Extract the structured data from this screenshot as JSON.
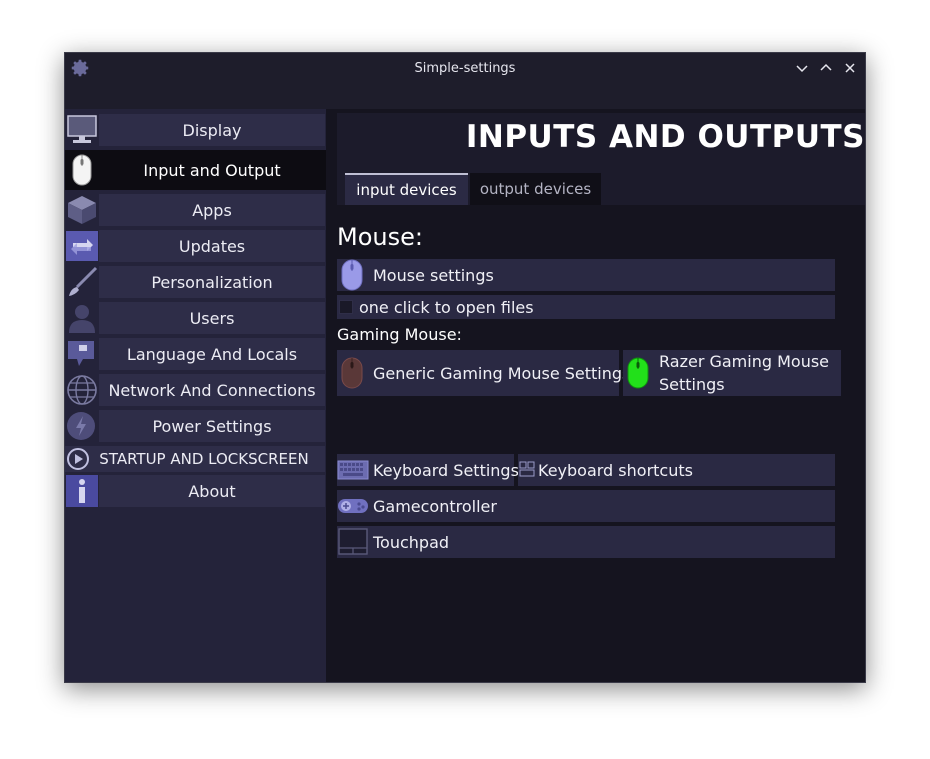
{
  "window": {
    "title": "Simple-settings"
  },
  "sidebar": {
    "items": [
      {
        "label": "Display",
        "icon": "monitor-icon"
      },
      {
        "label": "Input and Output",
        "icon": "mouse-icon"
      },
      {
        "label": "Apps",
        "icon": "package-icon"
      },
      {
        "label": "Updates",
        "icon": "refresh-icon"
      },
      {
        "label": "Personalization",
        "icon": "paintbrush-icon"
      },
      {
        "label": "Users",
        "icon": "user-icon"
      },
      {
        "label": "Language And Locals",
        "icon": "language-icon"
      },
      {
        "label": "Network And Connections",
        "icon": "globe-icon"
      },
      {
        "label": "Power Settings",
        "icon": "power-icon"
      },
      {
        "label": "STARTUP AND LOCKSCREEN",
        "icon": "play-icon"
      },
      {
        "label": "About",
        "icon": "info-icon"
      }
    ],
    "active_index": 1
  },
  "main": {
    "title": "INPUTS AND OUTPUTS",
    "tabs": [
      {
        "label": "input devices",
        "active": true
      },
      {
        "label": "output devices",
        "active": false
      }
    ],
    "mouse_heading": "Mouse:",
    "mouse_settings_label": "Mouse settings",
    "one_click_label": "one click to open files",
    "gaming_mouse_heading": "Gaming Mouse:",
    "generic_gaming_label": "Generic Gaming Mouse Settings",
    "razer_gaming_label_line1": "Razer Gaming Mouse",
    "razer_gaming_label_line2": "Settings",
    "keyboard_settings_label": "Keyboard Settings",
    "keyboard_shortcuts_label": "Keyboard shortcuts",
    "gamecontroller_label": "Gamecontroller",
    "touchpad_label": "Touchpad"
  },
  "colors": {
    "window_bg": "#15141f",
    "sidebar_bg": "#24233a",
    "button_bg": "#2a2943",
    "active_bg": "#0d0c12",
    "accent_purple": "#8f8fe0",
    "razer_green": "#22e01a"
  }
}
